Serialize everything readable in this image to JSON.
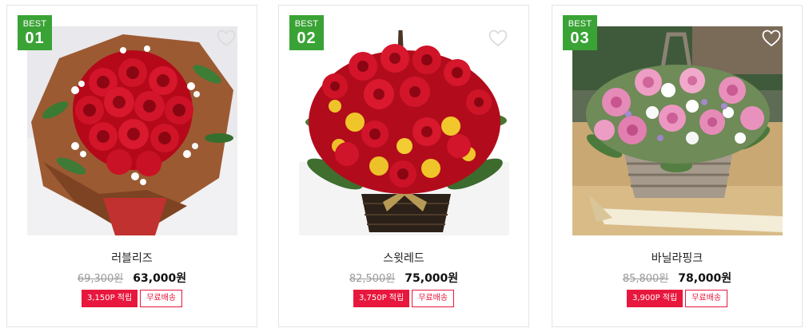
{
  "products": [
    {
      "badge_label": "BEST",
      "rank": "01",
      "name": "러블리즈",
      "original_price": "69,300원",
      "sale_price": "63,000원",
      "points": "3,150P 적립",
      "shipping": "무료배송",
      "photo_subject": "red rose bouquet wrapped in brown paper",
      "heart_color": "#dcdcdc"
    },
    {
      "badge_label": "BEST",
      "rank": "02",
      "name": "스윗레드",
      "original_price": "82,500원",
      "sale_price": "75,000원",
      "points": "3,750P 적립",
      "shipping": "무료배송",
      "photo_subject": "red rose and yellow flower basket",
      "heart_color": "#dcdcdc"
    },
    {
      "badge_label": "BEST",
      "rank": "03",
      "name": "바닐라핑크",
      "original_price": "85,800원",
      "sale_price": "78,000원",
      "points": "3,900P 적립",
      "shipping": "무료배송",
      "photo_subject": "pink rose wicker basket",
      "heart_color": "#ffffff"
    }
  ],
  "colors": {
    "badge_green": "#3aa335",
    "point_red": "#e8173d",
    "card_border": "#e4e4e4"
  }
}
